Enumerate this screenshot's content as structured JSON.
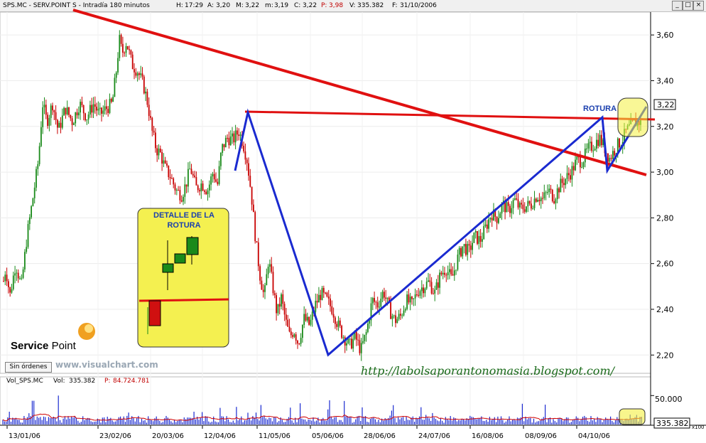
{
  "header": {
    "symbol": "SPS.MC - SERV.POINT S - Intradía 180 minutos",
    "h_label": "H:",
    "h_value": "17:29",
    "a_label": "A:",
    "a_value": "3,20",
    "m_label": "M:",
    "m_value": "3,22",
    "mn_label": "m:",
    "mn_value": "3,19",
    "c_label": "C:",
    "c_value": "3,22",
    "p_label": "P:",
    "p_value": "3,98",
    "v_label": "V:",
    "v_value": "335.382",
    "f_label": "F:",
    "f_value": "31/10/2006"
  },
  "window_buttons": [
    "_",
    "□",
    "×"
  ],
  "chart_data": [
    {
      "type": "candlestick",
      "title": "",
      "xlabel": "",
      "ylabel": "",
      "ylim": [
        2.12,
        3.7
      ],
      "yticks": [
        "3,60",
        "3,40",
        "3,20",
        "3,00",
        "2,80",
        "2,60",
        "2,40",
        "2,20"
      ],
      "ytick_values": [
        3.6,
        3.4,
        3.2,
        3.0,
        2.8,
        2.6,
        2.4,
        2.2
      ],
      "x_labels": [
        "13/01/06",
        "23/02/06",
        "20/03/06",
        "12/04/06",
        "11/05/06",
        "05/06/06",
        "28/06/06",
        "24/07/06",
        "16/08/06",
        "08/09/06",
        "04/10/06"
      ],
      "last_price_label": "3,22",
      "last_price": 3.22,
      "price_path": [
        [
          0,
          2.43
        ],
        [
          8,
          2.58
        ],
        [
          14,
          2.46
        ],
        [
          22,
          2.6
        ],
        [
          30,
          2.5
        ],
        [
          38,
          2.72
        ],
        [
          46,
          2.88
        ],
        [
          54,
          3.05
        ],
        [
          60,
          3.3
        ],
        [
          66,
          3.22
        ],
        [
          74,
          3.3
        ],
        [
          82,
          3.18
        ],
        [
          92,
          3.28
        ],
        [
          102,
          3.22
        ],
        [
          112,
          3.3
        ],
        [
          122,
          3.24
        ],
        [
          132,
          3.3
        ],
        [
          140,
          3.25
        ],
        [
          150,
          3.28
        ],
        [
          158,
          3.3
        ],
        [
          164,
          3.45
        ],
        [
          168,
          3.58
        ],
        [
          172,
          3.52
        ],
        [
          178,
          3.57
        ],
        [
          186,
          3.47
        ],
        [
          194,
          3.44
        ],
        [
          202,
          3.38
        ],
        [
          208,
          3.3
        ],
        [
          214,
          3.18
        ],
        [
          220,
          3.1
        ],
        [
          226,
          3.08
        ],
        [
          232,
          3.02
        ],
        [
          240,
          2.98
        ],
        [
          248,
          2.92
        ],
        [
          256,
          2.9
        ],
        [
          262,
          2.95
        ],
        [
          268,
          3.02
        ],
        [
          276,
          2.93
        ],
        [
          284,
          2.95
        ],
        [
          292,
          2.92
        ],
        [
          300,
          3.0
        ],
        [
          306,
          2.94
        ],
        [
          312,
          3.1
        ],
        [
          320,
          3.15
        ],
        [
          328,
          3.14
        ],
        [
          336,
          3.18
        ],
        [
          342,
          3.13
        ],
        [
          348,
          3.05
        ],
        [
          354,
          2.9
        ],
        [
          360,
          2.7
        ],
        [
          366,
          2.55
        ],
        [
          372,
          2.45
        ],
        [
          378,
          2.62
        ],
        [
          384,
          2.5
        ],
        [
          390,
          2.38
        ],
        [
          396,
          2.45
        ],
        [
          402,
          2.35
        ],
        [
          408,
          2.28
        ],
        [
          414,
          2.31
        ],
        [
          420,
          2.25
        ],
        [
          428,
          2.36
        ],
        [
          436,
          2.33
        ],
        [
          444,
          2.42
        ],
        [
          452,
          2.47
        ],
        [
          460,
          2.44
        ],
        [
          468,
          2.4
        ],
        [
          476,
          2.33
        ],
        [
          484,
          2.28
        ],
        [
          492,
          2.24
        ],
        [
          500,
          2.28
        ],
        [
          508,
          2.22
        ],
        [
          516,
          2.3
        ],
        [
          524,
          2.44
        ],
        [
          532,
          2.42
        ],
        [
          540,
          2.48
        ],
        [
          548,
          2.4
        ],
        [
          556,
          2.35
        ],
        [
          564,
          2.37
        ],
        [
          572,
          2.44
        ],
        [
          580,
          2.42
        ],
        [
          588,
          2.48
        ],
        [
          596,
          2.5
        ],
        [
          604,
          2.52
        ],
        [
          612,
          2.47
        ],
        [
          620,
          2.55
        ],
        [
          628,
          2.58
        ],
        [
          636,
          2.53
        ],
        [
          644,
          2.62
        ],
        [
          652,
          2.68
        ],
        [
          660,
          2.65
        ],
        [
          668,
          2.72
        ],
        [
          676,
          2.7
        ],
        [
          684,
          2.76
        ],
        [
          692,
          2.82
        ],
        [
          700,
          2.8
        ],
        [
          708,
          2.86
        ],
        [
          716,
          2.83
        ],
        [
          724,
          2.88
        ],
        [
          732,
          2.84
        ],
        [
          740,
          2.85
        ],
        [
          748,
          2.86
        ],
        [
          756,
          2.9
        ],
        [
          764,
          2.88
        ],
        [
          772,
          2.92
        ],
        [
          780,
          2.89
        ],
        [
          788,
          2.94
        ],
        [
          796,
          2.97
        ],
        [
          804,
          3.0
        ],
        [
          812,
          3.05
        ],
        [
          820,
          3.05
        ],
        [
          828,
          3.1
        ],
        [
          836,
          3.12
        ],
        [
          844,
          3.15
        ],
        [
          852,
          3.1
        ],
        [
          858,
          3.06
        ],
        [
          864,
          3.09
        ],
        [
          870,
          3.12
        ],
        [
          876,
          3.14
        ],
        [
          882,
          3.18
        ],
        [
          888,
          3.2
        ],
        [
          896,
          3.22
        ]
      ],
      "annotations": {
        "red_trendline": "bajista",
        "rotura_label": "ROTURA",
        "detail_box_title": "DETALLE DE LA ROTURA"
      }
    },
    {
      "type": "bar",
      "title": "Vol_SPS.MC",
      "series": [
        {
          "name": "Vol",
          "last_value": "335.382"
        }
      ],
      "ylim": [
        0,
        70000
      ],
      "yticks": [
        "50.000"
      ],
      "ytick_values": [
        50000
      ],
      "multiplier_label": "x100",
      "last_value_label": "335.382"
    }
  ],
  "volume_header": {
    "name": "Vol_SPS.MC",
    "vol_label": "Vol:",
    "vol_value": "335.382",
    "p_label": "P:",
    "p_value": "84.724.781"
  },
  "overlays": {
    "sin_ordenes": "Sin órdenes",
    "visualchart_url": "www.visualchart.com",
    "blog_url": "http://labolsaporantonomasia.blogspot.com/",
    "logo_bold": "Service",
    "logo_light": "Point",
    "detail_title_line1": "DETALLE DE LA",
    "detail_title_line2": "ROTURA",
    "rotura": "ROTURA"
  },
  "colors": {
    "up_candle": "#1a8a1a",
    "down_candle": "#c80000",
    "trendline": "#e01010",
    "pattern_line": "#1a2ad0",
    "highlight": "#f4f040",
    "blog_url": "#1a6b1a",
    "volume_bars": "#1a2ad0",
    "volume_avg": "#d00000"
  }
}
